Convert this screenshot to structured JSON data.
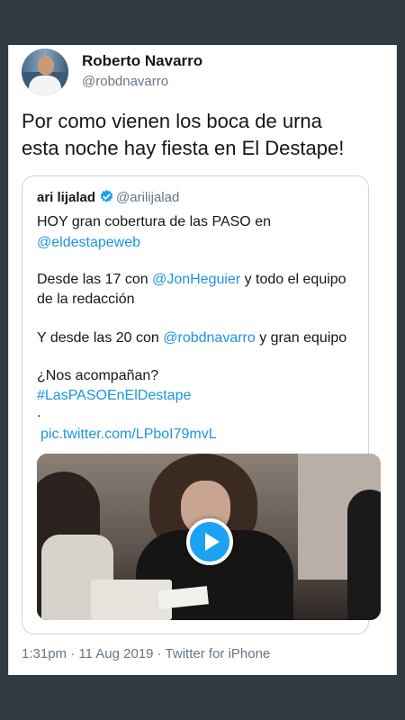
{
  "tweet": {
    "author_name": "Roberto Navarro",
    "author_handle": "@robdnavarro",
    "text_line1": "Por como vienen los boca de urna",
    "text_line2": "esta noche hay fiesta en El Destape!",
    "timestamp": "1:31pm · 11 Aug 2019 · Twitter for iPhone"
  },
  "quote": {
    "author_name": "ari lijalad",
    "author_handle": "@arilijalad",
    "verified_icon": "verified-badge",
    "line1": "HOY gran cobertura de las PASO en",
    "mention1": "@eldestapeweb",
    "line3a": "Desde las 17 con ",
    "mention2": "@JonHeguier",
    "line3b": " y todo el equipo",
    "line4": "de la redacción",
    "line5a": "Y desde las 20 con ",
    "mention3": "@robdnavarro",
    "line5b": " y gran equipo",
    "line6": "¿Nos acompañan?",
    "hashtag": "#LasPASOEnElDestape",
    "dot": ".",
    "pic_link": "pic.twitter.com/LPboI79mvL",
    "media_icon": "play-icon"
  },
  "colors": {
    "link": "#1b95e0",
    "play": "#1da1f2",
    "frame": "#2f3a42"
  }
}
